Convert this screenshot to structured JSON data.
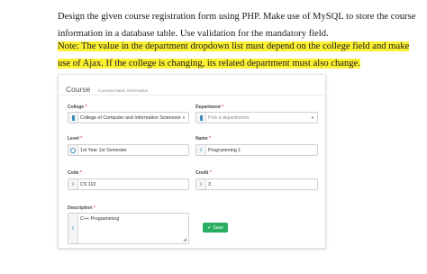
{
  "question": {
    "line1": "Design the given course registration form using PHP. Make use of MySQL to store the course",
    "line2": "information in a database table. Use validation for the mandatory field.",
    "note": "Note: The value in the department dropdown list must depend on the college field and make use of Ajax. If the college is changing, its related department must also change."
  },
  "form": {
    "title": "Course",
    "subtitle": "Courses basic information",
    "required_mark": "*",
    "college": {
      "label": "College",
      "value": "College of Computer and Information Sciences",
      "clear": "×"
    },
    "department": {
      "label": "Department",
      "placeholder": "Pick a departments"
    },
    "level": {
      "label": "Level",
      "value": "1st Year 1st Semester"
    },
    "name": {
      "label": "Name",
      "value": "Programming 1"
    },
    "code": {
      "label": "Code",
      "value": "CS 110"
    },
    "credit": {
      "label": "Credit",
      "value": "3"
    },
    "description": {
      "label": "Description",
      "value": "C++ Programming"
    },
    "save_label": "Save",
    "accent_color": "#3c8dbc",
    "save_color": "#27ae60"
  }
}
